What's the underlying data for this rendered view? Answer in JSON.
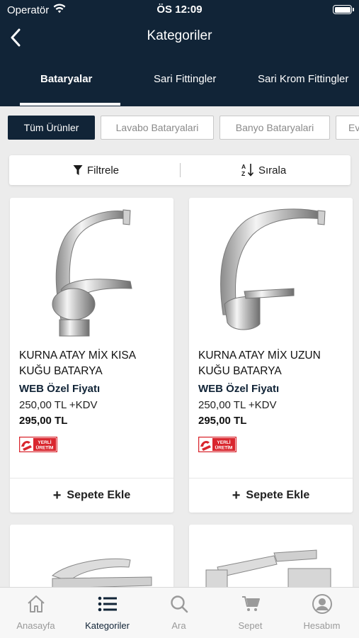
{
  "status_bar": {
    "carrier": "Operatör",
    "time": "ÖS 12:09"
  },
  "nav": {
    "title": "Kategoriler",
    "back_icon": "chevron-left-icon"
  },
  "category_tabs": [
    {
      "label": "Bataryalar",
      "active": true
    },
    {
      "label": "Sari Fittingler",
      "active": false
    },
    {
      "label": "Sari Krom Fittingler",
      "active": false
    }
  ],
  "subcategory_chips": [
    {
      "label": "Tüm Ürünler",
      "active": true
    },
    {
      "label": "Lavabo Bataryalari",
      "active": false
    },
    {
      "label": "Banyo Bataryalari",
      "active": false
    },
    {
      "label": "Ev",
      "active": false
    }
  ],
  "toolbar": {
    "filter_label": "Filtrele",
    "filter_icon": "funnel-icon",
    "sort_label": "Sırala",
    "sort_icon": "sort-az-icon"
  },
  "products": [
    {
      "name": "KURNA ATAY MİX KISA KUĞU BATARYA",
      "web_price_label": "WEB Özel Fiyatı",
      "price_excl_vat": "250,00 TL +KDV",
      "price_incl_vat": "295,00 TL",
      "badge": {
        "line1": "YERLİ",
        "line2": "ÜRETİM"
      },
      "add_to_cart": "Sepete Ekle"
    },
    {
      "name": "KURNA ATAY MİX UZUN KUĞU BATARYA",
      "web_price_label": "WEB Özel Fiyatı",
      "price_excl_vat": "250,00 TL +KDV",
      "price_incl_vat": "295,00 TL",
      "badge": {
        "line1": "YERLİ",
        "line2": "ÜRETİM"
      },
      "add_to_cart": "Sepete Ekle"
    }
  ],
  "bottom_nav": [
    {
      "label": "Anasayfa",
      "icon": "home-icon",
      "active": false
    },
    {
      "label": "Kategoriler",
      "icon": "list-icon",
      "active": true
    },
    {
      "label": "Ara",
      "icon": "search-icon",
      "active": false
    },
    {
      "label": "Sepet",
      "icon": "cart-icon",
      "active": false
    },
    {
      "label": "Hesabım",
      "icon": "account-icon",
      "active": false
    }
  ],
  "colors": {
    "primary": "#112437",
    "badge_red": "#d9262e",
    "background": "#ececec"
  }
}
